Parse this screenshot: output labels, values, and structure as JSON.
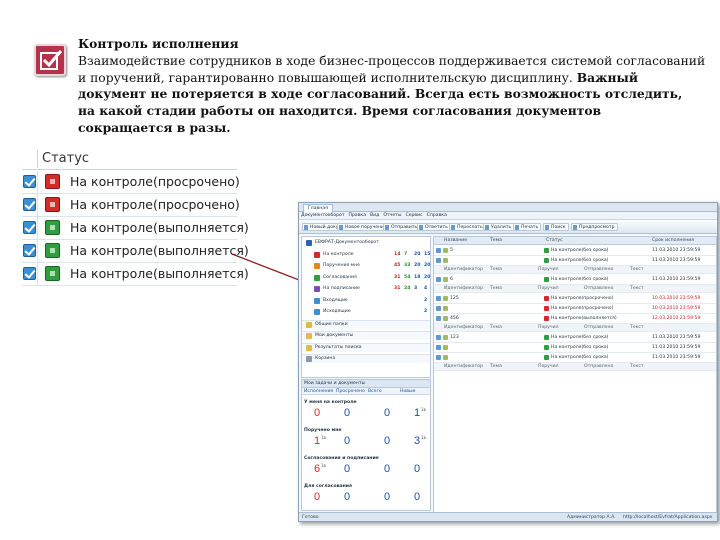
{
  "header": {
    "title": "Контроль исполнения",
    "line1": "Взаимодействие сотрудников в ходе бизнес-процессов поддерживается системой согласований",
    "line2_plain": "и поручений, гарантированно повышающей исполнительскую дисциплину.",
    "line2_bold": "Важный",
    "line3": "документ не потеряется в ходе согласований. Всегда есть возможность отследить,",
    "line4": "на какой стадии работы он находится. Время согласования документов",
    "line5": "сокращается в разы."
  },
  "status_column": {
    "header": "Статус",
    "rows": [
      {
        "text": "На контроле(просрочено)",
        "state": "overdue"
      },
      {
        "text": "На контроле(просрочено)",
        "state": "overdue"
      },
      {
        "text": "На контроле(выполняется)",
        "state": "in-progress"
      },
      {
        "text": "На контроле(выполняется)",
        "state": "in-progress"
      },
      {
        "text": "На контроле(выполняется)",
        "state": "in-progress"
      }
    ]
  },
  "colors": {
    "logo": "#b5334a",
    "overdue": "#d42a2a",
    "in_progress": "#2f9e3c",
    "arrow": "#8b1c1c",
    "checkbox": "#3d8fd4"
  },
  "app": {
    "tab": "Главная",
    "menu": [
      "Документооборот",
      "Правка",
      "Вид",
      "Отчеты",
      "Сервис",
      "Справка"
    ],
    "toolbar": [
      "Новый документ",
      "Новое поручение",
      "Отправить",
      "Ответить",
      "Переслать",
      "Удалить",
      "Печать",
      "Поиск",
      "Предпросмотр"
    ],
    "tree": [
      {
        "label": "ЕВФРАТ-Документооборот",
        "indent": 0,
        "icon": "system"
      },
      {
        "label": "На контроле",
        "indent": 1,
        "icon": "control",
        "n": [
          "14",
          "7",
          "20",
          "15"
        ]
      },
      {
        "label": "Поручения мне",
        "indent": 1,
        "icon": "tasks",
        "n": [
          "45",
          "33",
          "20",
          "20"
        ]
      },
      {
        "label": "Согласования",
        "indent": 1,
        "icon": "approvals",
        "n": [
          "31",
          "54",
          "18",
          "20"
        ]
      },
      {
        "label": "На подписание",
        "indent": 1,
        "icon": "sign",
        "n": [
          "31",
          "24",
          "3",
          "4"
        ]
      },
      {
        "label": "Входящие",
        "indent": 1,
        "icon": "inbox",
        "n": [
          "",
          "",
          "",
          "2"
        ]
      },
      {
        "label": "Исходящие",
        "indent": 1,
        "icon": "outbox",
        "n": [
          "",
          "",
          "",
          "2"
        ]
      },
      {
        "label": "Общие папки",
        "indent": 0,
        "icon": "folder"
      },
      {
        "label": "Мои документы",
        "indent": 0,
        "icon": "folder"
      },
      {
        "label": "Результаты поиска",
        "indent": 0,
        "icon": "folder"
      },
      {
        "label": "Корзина",
        "indent": 0,
        "icon": "trash"
      }
    ],
    "summary": {
      "header": "Мои задачи и документы",
      "tabs": [
        "Исполнение",
        "Просрочено",
        "Всего",
        "Новые"
      ],
      "sections": [
        {
          "title": "У меня на контроле",
          "nums": [
            "0",
            "0",
            "0",
            "1"
          ],
          "colors": [
            "red",
            "blue",
            "blue",
            "blue"
          ],
          "sup": [
            "",
            "",
            "",
            "1в"
          ]
        },
        {
          "title": "Поручено мне",
          "nums": [
            "1",
            "0",
            "0",
            "3"
          ],
          "colors": [
            "red",
            "blue",
            "blue",
            "blue"
          ],
          "sup": [
            "1в",
            "",
            "",
            "1в"
          ]
        },
        {
          "title": "Согласования и подписание",
          "nums": [
            "6",
            "0",
            "0",
            "0"
          ],
          "colors": [
            "red",
            "blue",
            "blue",
            "blue"
          ],
          "sup": [
            "1в",
            "",
            "",
            ""
          ]
        },
        {
          "title": "Для согласования",
          "nums": [
            "0",
            "0",
            "0",
            "0"
          ],
          "colors": [
            "red",
            "blue",
            "blue",
            "blue"
          ],
          "sup": [
            "",
            "",
            "",
            ""
          ]
        }
      ]
    },
    "grid": {
      "headers": [
        "Название",
        "Тема",
        "Статус",
        "Срок исполнения"
      ],
      "subheaders": [
        "Идентификатор",
        "Тема",
        "Поручил",
        "Отправлено",
        "Текст"
      ],
      "rows": [
        {
          "name": "5",
          "status": "На контроле(без срока)",
          "date": "11.03.2010 23:59:59",
          "state": "green"
        },
        {
          "name": "",
          "status": "На контроле(без срока)",
          "date": "11.03.2010 23:59:59",
          "state": "green"
        },
        {
          "name": "6",
          "status": "На контроле(без срока)",
          "date": "11.03.2010 23:59:59",
          "state": "green"
        },
        {
          "name": "125",
          "status": "На контроле(просрочено)",
          "date": "10.03.2010 23:59:59",
          "state": "red"
        },
        {
          "name": "",
          "status": "На контроле(просрочено)",
          "date": "10.03.2010 23:59:59",
          "state": "red"
        },
        {
          "name": "456",
          "status": "На контроле(выполняется)",
          "date": "12.03.2010 23:59:59",
          "state": "red"
        },
        {
          "name": "123",
          "status": "На контроле(без срока)",
          "date": "11.03.2010 23:59:59",
          "state": "green"
        },
        {
          "name": "",
          "status": "На контроле(без срока)",
          "date": "11.03.2010 23:59:59",
          "state": "green"
        },
        {
          "name": "",
          "status": "На контроле(без срока)",
          "date": "11.03.2010 23:59:59",
          "state": "green"
        }
      ]
    },
    "statusbar": {
      "left": "Готово",
      "user": "Администратор А.А.",
      "url": "http://localhost/Evfrat/Application.aspx"
    }
  }
}
